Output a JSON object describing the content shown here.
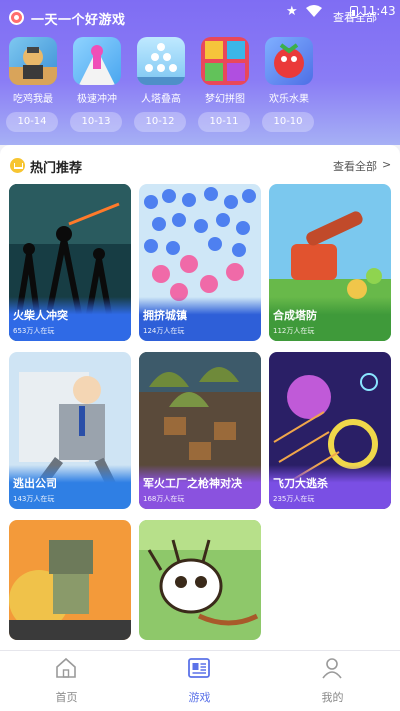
{
  "status_bar": {
    "clock": "11:43"
  },
  "header": {
    "app_title": "一天一个好游戏",
    "view_all": "查看全部"
  },
  "recent_games": [
    {
      "name": "吃鸡我最",
      "date": "10-14"
    },
    {
      "name": "极速冲冲",
      "date": "10-13"
    },
    {
      "name": "人塔叠高",
      "date": "10-12"
    },
    {
      "name": "梦幻拼图",
      "date": "10-11"
    },
    {
      "name": "欢乐水果",
      "date": "10-10"
    }
  ],
  "hot": {
    "title": "热门推荐",
    "view_all": "查看全部",
    "games": [
      {
        "name": "火柴人冲突",
        "players": "653万人在玩"
      },
      {
        "name": "拥挤城镇",
        "players": "124万人在玩"
      },
      {
        "name": "合成塔防",
        "players": "112万人在玩"
      },
      {
        "name": "逃出公司",
        "players": "143万人在玩"
      },
      {
        "name": "军火工厂之枪神对决",
        "players": "168万人在玩"
      },
      {
        "name": "飞刀大逃杀",
        "players": "235万人在玩"
      },
      {
        "name": "",
        "players": ""
      },
      {
        "name": "",
        "players": ""
      }
    ]
  },
  "bottom_nav": [
    {
      "label": "首页",
      "icon": "home-icon",
      "active": false
    },
    {
      "label": "游戏",
      "icon": "games-icon",
      "active": true
    },
    {
      "label": "我的",
      "icon": "profile-icon",
      "active": false
    }
  ],
  "colors": {
    "accent": "#5b72e8",
    "header_top": "#7f6df3",
    "header_bottom": "#a6b0f5"
  }
}
